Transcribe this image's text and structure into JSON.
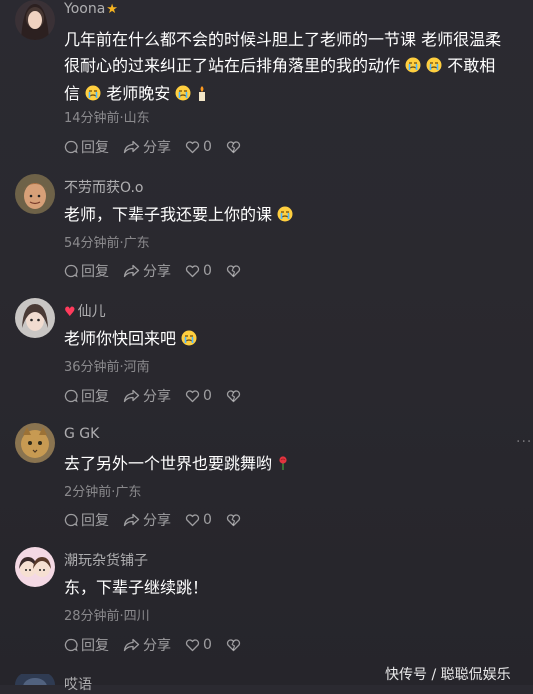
{
  "comments": [
    {
      "user": "Yoona",
      "text_line1": "几年前在什么都不会的时候斗胆上了老师的一节课 老师很温柔",
      "text_line2": "很耐心的过来纠正了站在后排角落里的我的动作",
      "text_line2b": "不敢相",
      "text_line3": "信",
      "text_line3b": "老师晚安",
      "meta": "14分钟前·山东",
      "reply": "回复",
      "share": "分享",
      "likes": "0"
    },
    {
      "user": "不劳而获O.o",
      "text": "老师，下辈子我还要上你的课",
      "meta": "54分钟前·广东",
      "reply": "回复",
      "share": "分享",
      "likes": "0"
    },
    {
      "user": "仙儿",
      "text": "老师你快回来吧",
      "meta": "36分钟前·河南",
      "reply": "回复",
      "share": "分享",
      "likes": "0"
    },
    {
      "user": "G GK",
      "text": "去了另外一个世界也要跳舞哟",
      "meta": "2分钟前·广东",
      "reply": "回复",
      "share": "分享",
      "likes": "0"
    },
    {
      "user": "潮玩杂货铺子",
      "text": "东，下辈子继续跳！",
      "meta": "28分钟前·四川",
      "reply": "回复",
      "share": "分享",
      "likes": "0"
    },
    {
      "user": "哎语"
    }
  ],
  "more_label": "···",
  "watermark": "快传号 / 聪聪侃娱乐",
  "colors": {
    "background": "#2a292f",
    "accent_star": "#f5b321",
    "heart_badge": "#ff3b5c"
  }
}
